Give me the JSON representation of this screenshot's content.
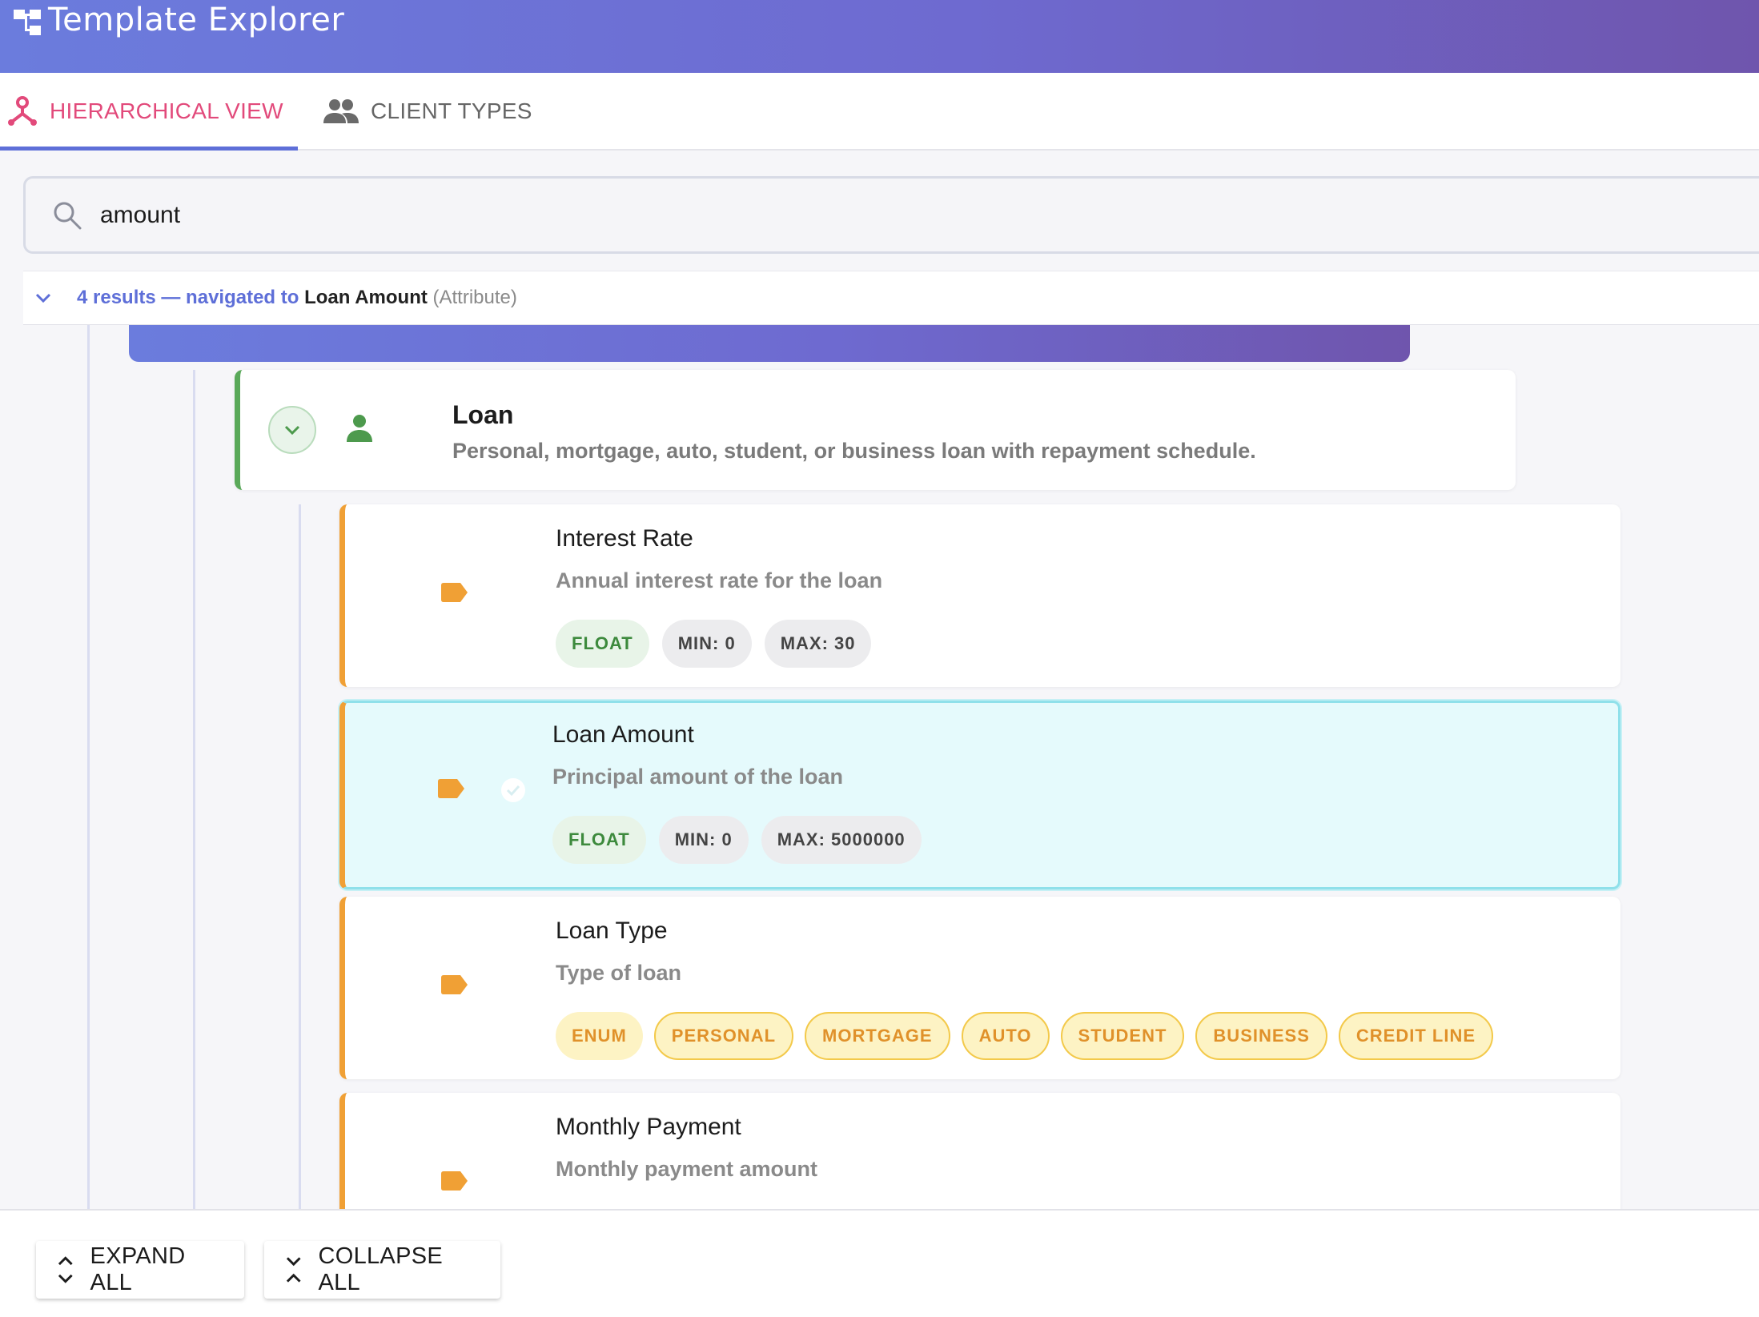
{
  "app": {
    "title": "Template Explorer"
  },
  "tabs": [
    {
      "label": "HIERARCHICAL VIEW",
      "icon": "hierarchy-icon",
      "active": true
    },
    {
      "label": "CLIENT TYPES",
      "icon": "people-icon",
      "active": false
    }
  ],
  "search": {
    "value": "amount",
    "placeholder": ""
  },
  "results": {
    "count_text": "4 results",
    "navigated_text": "— navigated to",
    "target": "Loan Amount",
    "target_kind": "(Attribute)"
  },
  "tree": {
    "parent": {
      "title": "Loan",
      "description": "Personal, mortgage, auto, student, or business loan with repayment schedule."
    },
    "attributes": [
      {
        "title": "Interest Rate",
        "description": "Annual interest rate for the loan",
        "chips": [
          "FLOAT",
          "MIN: 0",
          "MAX: 30"
        ]
      },
      {
        "title": "Loan Amount",
        "description": "Principal amount of the loan",
        "chips": [
          "FLOAT",
          "MIN: 0",
          "MAX: 5000000"
        ],
        "selected": true
      },
      {
        "title": "Loan Type",
        "description": "Type of loan",
        "chips": [
          "ENUM",
          "PERSONAL",
          "MORTGAGE",
          "AUTO",
          "STUDENT",
          "BUSINESS",
          "CREDIT LINE"
        ]
      },
      {
        "title": "Monthly Payment",
        "description": "Monthly payment amount",
        "chips": []
      }
    ]
  },
  "toolbar": {
    "expand_all_label": "EXPAND ALL",
    "collapse_all_label": "COLLAPSE ALL"
  },
  "colors": {
    "accent": "#5e6fd8",
    "active_tab": "#e24a7b",
    "parent_border": "#5aa95a",
    "attribute_border": "#f0a035",
    "selected_background": "#e5fafc"
  }
}
